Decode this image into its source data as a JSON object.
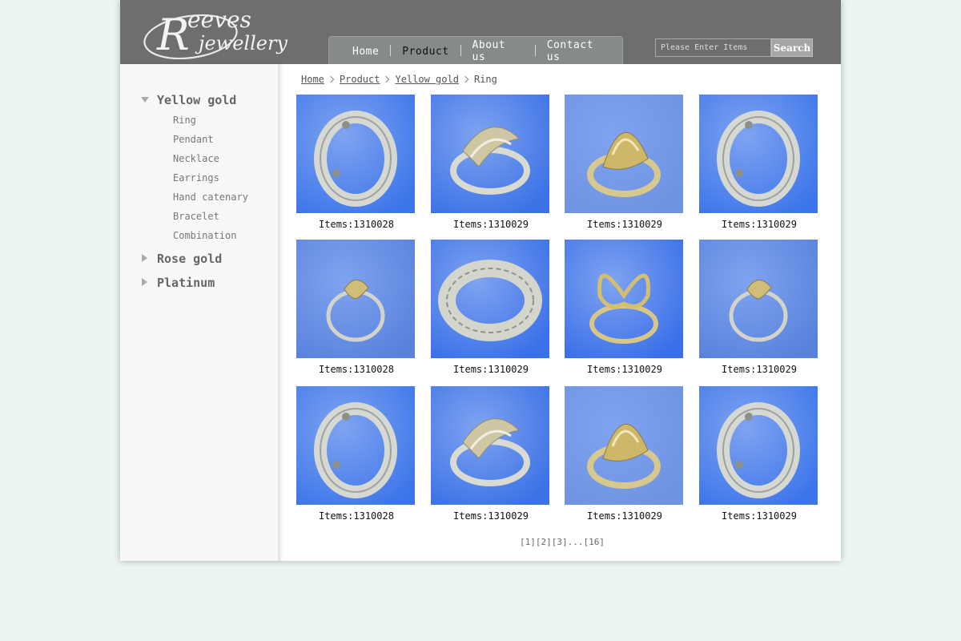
{
  "brand": {
    "logo_line1": "eeves",
    "logo_initial": "R",
    "logo_line2": "jewellery"
  },
  "nav": {
    "items": [
      {
        "label": "Home",
        "active": false
      },
      {
        "label": "Product",
        "active": true
      },
      {
        "label": "About us",
        "active": false
      },
      {
        "label": "Contact us",
        "active": false
      }
    ]
  },
  "search": {
    "placeholder": "Please Enter Items",
    "button_label": "Search"
  },
  "sidebar": {
    "categories": [
      {
        "label": "Yellow gold",
        "expanded": true,
        "subitems": [
          "Ring",
          "Pendant",
          "Necklace",
          "Earrings",
          "Hand catenary",
          "Bracelet",
          "Combination"
        ]
      },
      {
        "label": "Rose gold",
        "expanded": false
      },
      {
        "label": "Platinum",
        "expanded": false
      }
    ]
  },
  "breadcrumb": {
    "items": [
      "Home",
      "Product",
      "Yellow gold"
    ],
    "current": "Ring"
  },
  "products": [
    {
      "caption": "Items:1310028",
      "image": "screw-band-ring"
    },
    {
      "caption": "Items:1310029",
      "image": "leaf-openwork-ring"
    },
    {
      "caption": "Items:1310029",
      "image": "filigree-dome-ring"
    },
    {
      "caption": "Items:1310029",
      "image": "screw-band-ring"
    },
    {
      "caption": "Items:1310028",
      "image": "heart-knot-ring"
    },
    {
      "caption": "Items:1310029",
      "image": "pattern-band-ring"
    },
    {
      "caption": "Items:1310029",
      "image": "butterfly-ring"
    },
    {
      "caption": "Items:1310029",
      "image": "heart-knot-ring"
    },
    {
      "caption": "Items:1310028",
      "image": "screw-band-ring"
    },
    {
      "caption": "Items:1310029",
      "image": "leaf-openwork-ring"
    },
    {
      "caption": "Items:1310029",
      "image": "filigree-dome-ring"
    },
    {
      "caption": "Items:1310029",
      "image": "screw-band-ring"
    }
  ],
  "pagination": {
    "pages": [
      "[1]",
      "[2]",
      "[3]",
      "...",
      "[16]"
    ]
  },
  "colors": {
    "header": "#6e6e6e",
    "nav": "#878a8a",
    "photo_bg": "#3f74e0",
    "gold": "#cdb86a",
    "silver": "#c9cbc4"
  }
}
